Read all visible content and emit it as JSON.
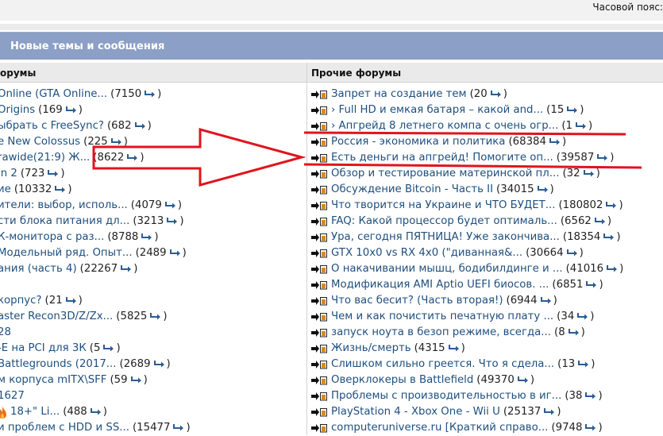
{
  "header": {
    "timezone_text": "Часовой пояс:"
  },
  "panel": {
    "title": "Новые темы и сообщения",
    "left_header": "орумы",
    "right_header": "Прочие форумы"
  },
  "left_items": [
    {
      "title": "Online (GTA Online...",
      "count": "7150"
    },
    {
      "title": "Origins",
      "count": "169"
    },
    {
      "title": "ыбрать с FreeSync?",
      "count": "682"
    },
    {
      "title": "e New Colossus",
      "count": "225"
    },
    {
      "title": "rawide(21:9) Ж...",
      "count": "8622"
    },
    {
      "title": "in 2",
      "count": "723"
    },
    {
      "title": "ие",
      "count": "10332"
    },
    {
      "title": "ители: выбор, исполь...",
      "count": "4079"
    },
    {
      "title": "сти блока питания дл...",
      "count": "3213"
    },
    {
      "title": "К-монитора с раз...",
      "count": "8788"
    },
    {
      "title": "Модельный ряд. Опыт...",
      "count": "2489"
    },
    {
      "title": "ания (часть 4)",
      "count": "22267"
    },
    {
      "title": "",
      "count": ""
    },
    {
      "title": "корпус?",
      "count": "21"
    },
    {
      "title": "aster Recon3D/Z/Zx...",
      "count": "5825"
    },
    {
      "title": "28",
      "count": ""
    },
    {
      "title": "-E на PCI для 3К",
      "count": "5"
    },
    {
      "title": "Battlegrounds (2017...",
      "count": "2689"
    },
    {
      "title": "м корпуса mITX\\SFF",
      "count": "59"
    },
    {
      "title": "1627",
      "count": ""
    },
    {
      "title": "18+\" Li...",
      "count": "488",
      "fire": true
    },
    {
      "title": "и проблем с HDD и SS...",
      "count": "15477"
    }
  ],
  "right_items": [
    {
      "title": "Запрет на создание тем",
      "count": "20"
    },
    {
      "title": "› Full HD и емкая батаря – какой and...",
      "count": "15"
    },
    {
      "title": "› Апгрейд 8 летнего компа с очень огр...",
      "count": "1"
    },
    {
      "title": "Россия - экономика и политика",
      "count": "68384"
    },
    {
      "title": "Есть деньги на апгрейд! Помогите оп...",
      "count": "39587"
    },
    {
      "title": "Обзор и тестирование материнской пл...",
      "count": "32"
    },
    {
      "title": "Обсуждение Bitcoin - Часть II",
      "count": "34015"
    },
    {
      "title": "Что творится на Украине и ЧТО БУДЕТ...",
      "count": "180802"
    },
    {
      "title": "FAQ: Какой процессор будет оптималь...",
      "count": "6562"
    },
    {
      "title": "Ура, сегодня ПЯТНИЦА! Уже закончива...",
      "count": "18354"
    },
    {
      "title": "GTX 10x0 vs RX 4x0 (\"диванная&...",
      "count": "30664"
    },
    {
      "title": "О накачивании мышц, бодибилдинге и ...",
      "count": "41016"
    },
    {
      "title": "Модификация AMI Aptio UEFI биосов. ...",
      "count": "6851"
    },
    {
      "title": "Что вас бесит? (Часть вторая!)",
      "count": "6944"
    },
    {
      "title": "Чем и как почистить печатную плату ...",
      "count": "34"
    },
    {
      "title": "запуск ноута в безоп режиме, всегда...",
      "count": "8"
    },
    {
      "title": "Жизнь/смерть",
      "count": "4315"
    },
    {
      "title": "Слишком сильно греется. Что я сдела...",
      "count": "13"
    },
    {
      "title": "Оверклокеры в Battlefield",
      "count": "49370"
    },
    {
      "title": "Проблемы с производительностью в иг...",
      "count": "38"
    },
    {
      "title": "PlayStation 4 - Xbox One - Wii U",
      "count": "25137"
    },
    {
      "title": "computeruniverse.ru [Краткий справо...",
      "count": "9748"
    }
  ],
  "annotation": {
    "color": "#e0141e"
  },
  "colors": {
    "header_bg": "#8c9fc6",
    "link": "#1f4f7e"
  }
}
